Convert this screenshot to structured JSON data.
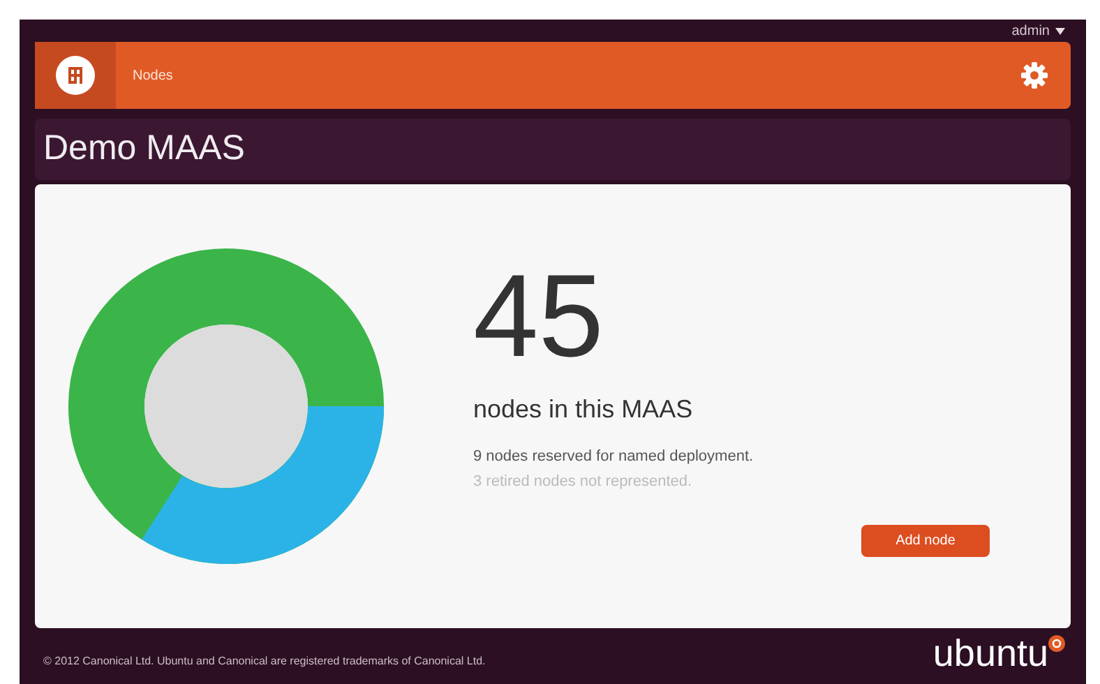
{
  "user_menu": {
    "label": "admin"
  },
  "nav": {
    "items": [
      {
        "label": "Nodes"
      }
    ]
  },
  "title": "Demo MAAS",
  "summary": {
    "count": "45",
    "label": "nodes in this MAAS",
    "reserved": "9 nodes reserved for named deployment.",
    "retired": "3 retired nodes not represented."
  },
  "add_button": "Add node",
  "footer": {
    "copyright": "© 2012 Canonical Ltd. Ubuntu and Canonical are registered trademarks of Canonical Ltd.",
    "logo": "ubuntu"
  }
}
